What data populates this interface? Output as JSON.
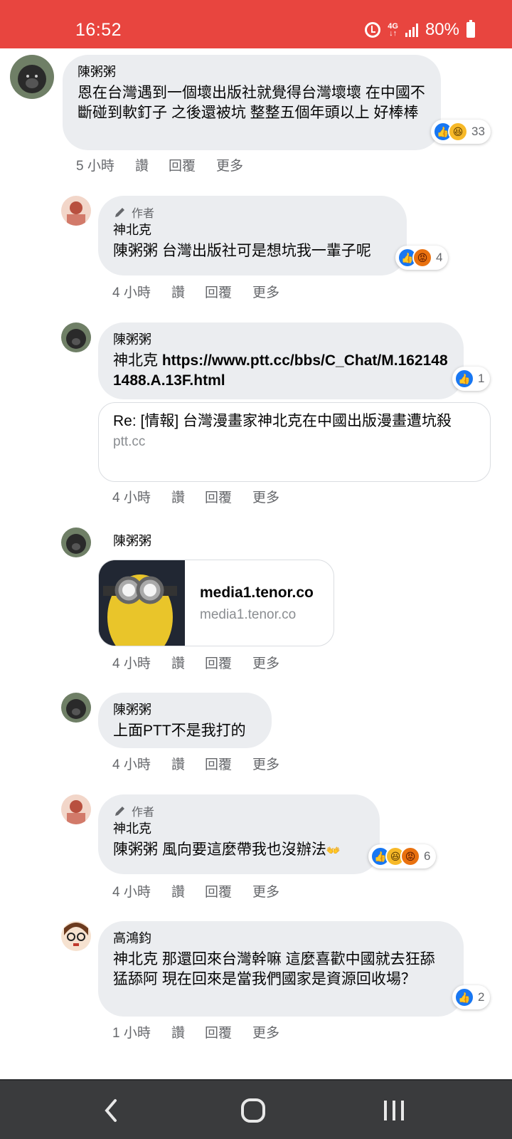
{
  "status_bar": {
    "time": "16:52",
    "network": "4G",
    "battery": "80%",
    "bg_color": "#e8453f"
  },
  "actions": {
    "like": "讚",
    "reply": "回覆",
    "more": "更多"
  },
  "author_badge": "作者",
  "comments": [
    {
      "name": "陳粥粥",
      "text": "恩在台灣遇到一個壞出版社就覺得台灣壞壞 在中國不斷碰到軟釘子 之後還被坑 整整五個年頭以上 好棒棒",
      "time": "5 小時",
      "reaction_count": "33"
    },
    {
      "name": "神北克",
      "text": "陳粥粥 台灣出版社可是想坑我一輩子呢",
      "time": "4 小時",
      "reaction_count": "4"
    },
    {
      "name": "陳粥粥",
      "text_prefix": "神北克 ",
      "text_link": "https://www.ptt.cc/bbs/C_Chat/M.1621481488.A.13F.html",
      "time": "4 小時",
      "reaction_count": "1",
      "link_card": {
        "title": "Re: [情報] 台灣漫畫家神北克在中國出版漫畫遭坑殺",
        "domain": "ptt.cc"
      }
    },
    {
      "name": "陳粥粥",
      "time": "4 小時",
      "gif_card": {
        "title": "media1.tenor.co",
        "domain": "media1.tenor.co"
      }
    },
    {
      "name": "陳粥粥",
      "text": "上面PTT不是我打的",
      "time": "4 小時"
    },
    {
      "name": "神北克",
      "text": "陳粥粥 風向要這麼帶我也沒辦法",
      "emoji": "👐",
      "time": "4 小時",
      "reaction_count": "6"
    },
    {
      "name": "高鴻鈞",
      "text": "神北克 那還回來台灣幹嘛 這麼喜歡中國就去狂舔猛舔阿 現在回來是當我們國家是資源回收場？",
      "time": "1 小時",
      "reaction_count": "2"
    }
  ],
  "icons": {
    "back": "back-icon",
    "home": "home-icon",
    "recents": "recents-icon"
  }
}
